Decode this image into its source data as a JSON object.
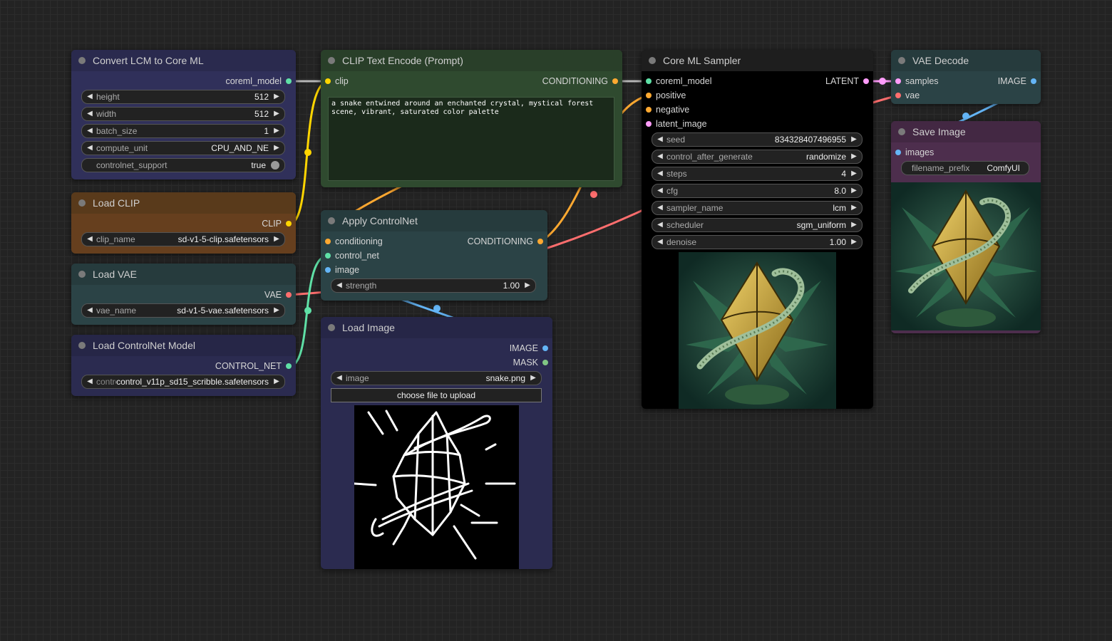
{
  "colors": {
    "clip": "#ffd500",
    "conditioning": "#ffa931",
    "model": "#b39ddb",
    "latent": "#ff9cf9",
    "vae": "#ff6e6e",
    "image": "#64b5f6",
    "control_net": "#00d78d",
    "mask": "#81c784"
  },
  "nodes": {
    "convert_lcm": {
      "title": "Convert LCM to Core ML",
      "output": "coreml_model",
      "widgets": [
        {
          "label": "height",
          "value": "512"
        },
        {
          "label": "width",
          "value": "512"
        },
        {
          "label": "batch_size",
          "value": "1"
        },
        {
          "label": "compute_unit",
          "value": "CPU_AND_NE"
        }
      ],
      "toggle": {
        "label": "controlnet_support",
        "value": "true"
      }
    },
    "load_clip": {
      "title": "Load CLIP",
      "output": "CLIP",
      "widget": {
        "label": "clip_name",
        "value": "sd-v1-5-clip.safetensors"
      }
    },
    "load_vae": {
      "title": "Load VAE",
      "output": "VAE",
      "widget": {
        "label": "vae_name",
        "value": "sd-v1-5-vae.safetensors"
      }
    },
    "load_controlnet": {
      "title": "Load ControlNet Model",
      "output": "CONTROL_NET",
      "widget": {
        "label": "control_net_name",
        "value": "control_v11p_sd15_scribble.safetensors"
      }
    },
    "clip_text": {
      "title": "CLIP Text Encode (Prompt)",
      "input": "clip",
      "output": "CONDITIONING",
      "text": "a snake entwined around an enchanted crystal, mystical forest scene, vibrant, saturated color palette"
    },
    "apply_controlnet": {
      "title": "Apply ControlNet",
      "inputs": [
        "conditioning",
        "control_net",
        "image"
      ],
      "output": "CONDITIONING",
      "widget": {
        "label": "strength",
        "value": "1.00"
      }
    },
    "load_image": {
      "title": "Load Image",
      "outputs": [
        "IMAGE",
        "MASK"
      ],
      "widget": {
        "label": "image",
        "value": "snake.png"
      },
      "upload_label": "choose file to upload"
    },
    "sampler": {
      "title": "Core ML Sampler",
      "inputs": [
        "coreml_model",
        "positive",
        "negative",
        "latent_image"
      ],
      "output": "LATENT",
      "widgets": [
        {
          "label": "seed",
          "value": "834328407496955"
        },
        {
          "label": "control_after_generate",
          "value": "randomize"
        },
        {
          "label": "steps",
          "value": "4"
        },
        {
          "label": "cfg",
          "value": "8.0"
        },
        {
          "label": "sampler_name",
          "value": "lcm"
        },
        {
          "label": "scheduler",
          "value": "sgm_uniform"
        },
        {
          "label": "denoise",
          "value": "1.00"
        }
      ]
    },
    "vae_decode": {
      "title": "VAE Decode",
      "inputs": [
        "samples",
        "vae"
      ],
      "output": "IMAGE"
    },
    "save_image": {
      "title": "Save Image",
      "input": "images",
      "widget": {
        "label": "filename_prefix",
        "value": "ComfyUI"
      }
    }
  }
}
